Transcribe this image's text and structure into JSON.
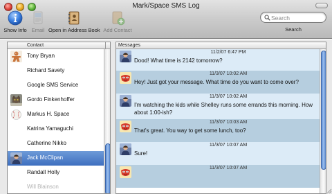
{
  "window": {
    "title": "Mark/Space SMS Log"
  },
  "toolbar": {
    "items": [
      {
        "label": "Show Info",
        "icon": "info-icon",
        "enabled": true
      },
      {
        "label": "Email",
        "icon": "email-icon",
        "enabled": false
      },
      {
        "label": "Open in Address Book",
        "icon": "address-book-icon",
        "enabled": true
      },
      {
        "label": "Add Contact",
        "icon": "add-contact-icon",
        "enabled": false
      }
    ],
    "search": {
      "placeholder": "Search",
      "label": "Search",
      "value": ""
    }
  },
  "contacts": {
    "column_header": "Contact",
    "items": [
      {
        "name": "Tony Bryan",
        "avatar": "gingerbread-avatar-icon",
        "selected": false
      },
      {
        "name": "Richard Savety",
        "avatar": "",
        "selected": false
      },
      {
        "name": "Google SMS Service",
        "avatar": "",
        "selected": false
      },
      {
        "name": "Gordo Finkenhoffer",
        "avatar": "cat-avatar-icon",
        "selected": false
      },
      {
        "name": "Markus H. Space",
        "avatar": "baseball-avatar-icon",
        "selected": false
      },
      {
        "name": "Katrina Yamaguchi",
        "avatar": "",
        "selected": false
      },
      {
        "name": "Catherine Nikko",
        "avatar": "",
        "selected": false
      },
      {
        "name": "Jack McClipan",
        "avatar": "person-photo-avatar-icon",
        "selected": true
      },
      {
        "name": "Randall Holly",
        "avatar": "",
        "selected": false
      },
      {
        "name": "Will Blainson",
        "avatar": "",
        "selected": false
      }
    ]
  },
  "messages": {
    "column_header": "Messages",
    "items": [
      {
        "time": "11/2/07 6:47 PM",
        "text": "Dood! What time is 2142 tomorrow?",
        "from": "contact",
        "avatar": "person-photo-avatar-icon"
      },
      {
        "time": "11/3/07 10:02 AM",
        "text": "Hey!  Just got your message.  What time do you want to come over?",
        "from": "me",
        "avatar": "mask-avatar-icon"
      },
      {
        "time": "11/3/07 10:02 AM",
        "text": "I'm watching the kids while Shelley runs some errands this morning. How about 1:00-ish?",
        "from": "contact",
        "avatar": "person-photo-avatar-icon"
      },
      {
        "time": "11/3/07 10:03 AM",
        "text": "That's great.  You way to get some lunch, too?",
        "from": "me",
        "avatar": "mask-avatar-icon"
      },
      {
        "time": "11/3/07 10:07 AM",
        "text": "Sure!",
        "from": "contact",
        "avatar": "person-photo-avatar-icon"
      },
      {
        "time": "11/3/07 10:07 AM",
        "text": "",
        "from": "me",
        "avatar": "mask-avatar-icon"
      }
    ]
  },
  "colors": {
    "selection": "#3e6fbf",
    "incoming_bg": "#dcebf7",
    "outgoing_bg": "#b6cedf",
    "toolbar_top": "#e3e3e3",
    "toolbar_bottom": "#b9b9b9"
  }
}
